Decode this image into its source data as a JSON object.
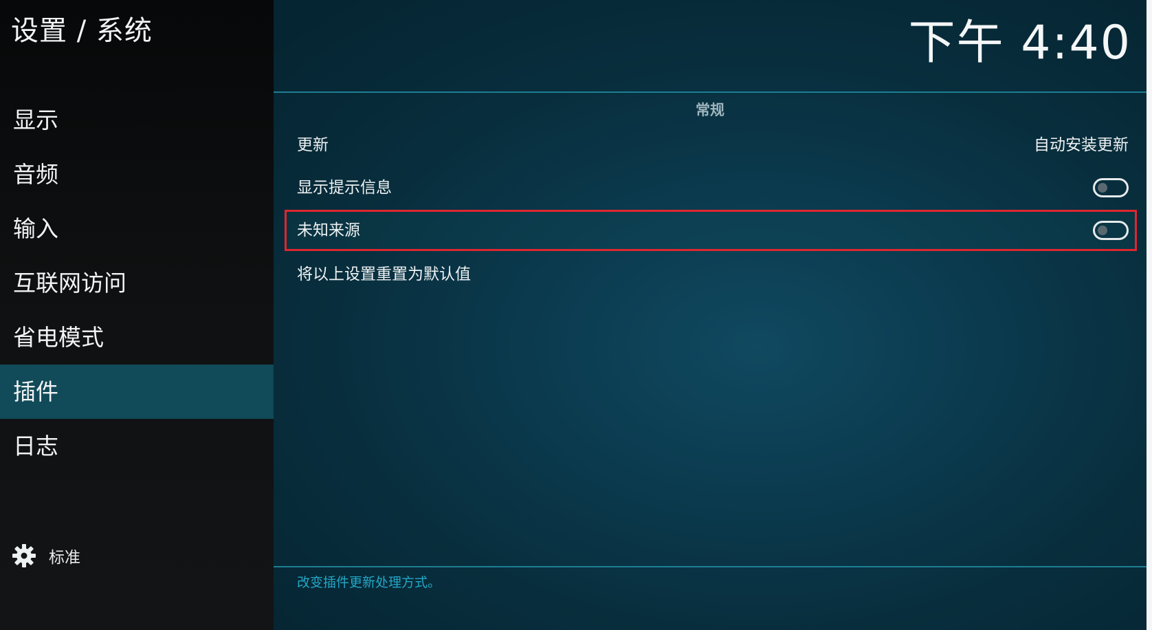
{
  "header": {
    "breadcrumb": "设置 / 系统",
    "clock": "下午 4:40"
  },
  "sidebar": {
    "items": [
      {
        "label": "显示"
      },
      {
        "label": "音频"
      },
      {
        "label": "输入"
      },
      {
        "label": "互联网访问"
      },
      {
        "label": "省电模式"
      },
      {
        "label": "插件",
        "active": true
      },
      {
        "label": "日志"
      }
    ],
    "settings_level": {
      "icon": "gear-icon",
      "label": "标准"
    }
  },
  "main": {
    "group_title": "常规",
    "settings": {
      "updates": {
        "label": "更新",
        "value": "自动安装更新"
      },
      "show_notifications": {
        "label": "显示提示信息",
        "enabled": false
      },
      "unknown_sources": {
        "label": "未知来源",
        "enabled": false
      },
      "reset": {
        "label": "将以上设置重置为默认值"
      }
    },
    "help_text": "改变插件更新处理方式。"
  },
  "colors": {
    "accent": "#114a58",
    "highlight_border": "#e0262f",
    "help_text": "#22a7c7"
  }
}
